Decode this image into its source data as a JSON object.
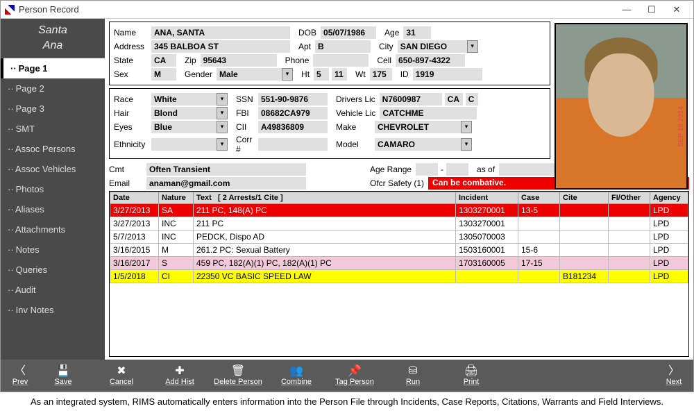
{
  "window": {
    "title": "Person Record"
  },
  "sidebar": {
    "first_name": "Santa",
    "last_name": "Ana",
    "items": [
      {
        "label": "Page 1",
        "selected": true
      },
      {
        "label": "Page 2"
      },
      {
        "label": "Page 3"
      },
      {
        "label": "SMT"
      },
      {
        "label": "Assoc Persons"
      },
      {
        "label": "Assoc Vehicles"
      },
      {
        "label": "Photos"
      },
      {
        "label": "Aliases"
      },
      {
        "label": "Attachments"
      },
      {
        "label": "Notes"
      },
      {
        "label": "Queries"
      },
      {
        "label": "Audit"
      },
      {
        "label": "Inv Notes"
      }
    ]
  },
  "labels": {
    "name": "Name",
    "dob": "DOB",
    "age": "Age",
    "address": "Address",
    "apt": "Apt",
    "city": "City",
    "state": "State",
    "zip": "Zip",
    "phone": "Phone",
    "cell": "Cell",
    "sex": "Sex",
    "gender": "Gender",
    "ht": "Ht",
    "wt": "Wt",
    "id": "ID",
    "race": "Race",
    "ssn": "SSN",
    "drivers_lic": "Drivers Lic",
    "hair": "Hair",
    "fbi": "FBI",
    "vehicle_lic": "Vehicle Lic",
    "eyes": "Eyes",
    "cii": "CII",
    "make": "Make",
    "ethnicity": "Ethnicity",
    "corr": "Corr #",
    "model": "Model",
    "cmt": "Cmt",
    "email": "Email",
    "age_range": "Age Range",
    "as_of": "as of",
    "ofcr_safety": "Ofcr Safety (1)"
  },
  "person": {
    "name": "ANA, SANTA",
    "dob": "05/07/1986",
    "age": "31",
    "address": "345 BALBOA ST",
    "apt": "B",
    "city": "SAN DIEGO",
    "state": "CA",
    "zip": "95643",
    "phone": "",
    "cell": "650-897-4322",
    "sex": "M",
    "gender": "Male",
    "ht1": "5",
    "ht2": "11",
    "wt": "175",
    "id": "1919",
    "race": "White",
    "ssn": "551-90-9876",
    "drivers_lic": "N7600987",
    "dl_state": "CA",
    "dl_class": "C",
    "hair": "Blond",
    "fbi": "08682CA979",
    "vehicle_lic": "CATCHME",
    "eyes": "Blue",
    "cii": "A49836809",
    "make": "CHEVROLET",
    "ethnicity": "",
    "corr": "",
    "model": "CAMARO",
    "cmt": "Often Transient",
    "email": "anaman@gmail.com",
    "age_from": "",
    "age_to": "",
    "as_of": "",
    "safety": "Can be combative."
  },
  "photo": {
    "date_stamp": "SEP 18 2014"
  },
  "history": {
    "headers": {
      "date": "Date",
      "nature": "Nature",
      "text": "Text",
      "text_note": "[ 2 Arrests/1 Cite ]",
      "incident": "Incident",
      "case": "Case",
      "cite": "Cite",
      "fi": "FI/Other",
      "agency": "Agency"
    },
    "rows": [
      {
        "date": "3/27/2013",
        "nature": "SA",
        "text": "211 PC, 148(A) PC",
        "incident": "1303270001",
        "case": "13-5",
        "cite": "",
        "fi": "",
        "agency": "LPD",
        "hl": "red"
      },
      {
        "date": "3/27/2013",
        "nature": "INC",
        "text": "211 PC",
        "incident": "1303270001",
        "case": "",
        "cite": "",
        "fi": "",
        "agency": "LPD",
        "hl": ""
      },
      {
        "date": "5/7/2013",
        "nature": "INC",
        "text": "PEDCK, Dispo AD",
        "incident": "1305070003",
        "case": "",
        "cite": "",
        "fi": "",
        "agency": "LPD",
        "hl": ""
      },
      {
        "date": "3/16/2015",
        "nature": "M",
        "text": "261.2 PC: Sexual Battery",
        "incident": "1503160001",
        "case": "15-6",
        "cite": "",
        "fi": "",
        "agency": "LPD",
        "hl": ""
      },
      {
        "date": "3/16/2017",
        "nature": "S",
        "text": "459 PC, 182(A)(1) PC, 182(A)(1) PC",
        "incident": "1703160005",
        "case": "17-15",
        "cite": "",
        "fi": "",
        "agency": "LPD",
        "hl": "pink"
      },
      {
        "date": "1/5/2018",
        "nature": "CI",
        "text": "22350 VC  BASIC SPEED LAW",
        "incident": "",
        "case": "",
        "cite": "B181234",
        "fi": "",
        "agency": "LPD",
        "hl": "yellow"
      }
    ]
  },
  "toolbar": {
    "prev": "Prev",
    "save": "Save",
    "cancel": "Cancel",
    "add_hist": "Add Hist",
    "delete": "Delete Person",
    "combine": "Combine",
    "tag": "Tag Person",
    "run": "Run",
    "print": "Print",
    "next": "Next"
  },
  "caption": "As an integrated system, RIMS automatically enters information into the Person File through Incidents, Case Reports, Citations, Warrants and Field Interviews."
}
